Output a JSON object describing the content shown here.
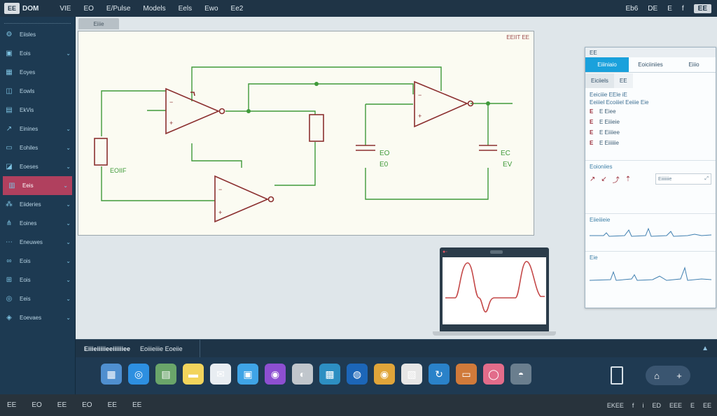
{
  "topbar": {
    "logo": "EE",
    "menu": [
      "DOM",
      "VIE",
      "EO",
      "E/Pulse",
      "Models",
      "Eels",
      "Ewo",
      "Ee2"
    ],
    "right": [
      "Eb6",
      "DE",
      "E",
      "f",
      "EE"
    ]
  },
  "sidebar": {
    "items": [
      {
        "icon": "gear-icon",
        "glyph": "⚙",
        "label": "Eiisles",
        "chevron": false
      },
      {
        "icon": "chip-icon",
        "glyph": "▣",
        "label": "Eois",
        "chevron": true
      },
      {
        "icon": "grid-icon",
        "glyph": "▦",
        "label": "Eoyes",
        "chevron": false
      },
      {
        "icon": "component-icon",
        "glyph": "◫",
        "label": "Eowls",
        "chevron": false
      },
      {
        "icon": "device-icon",
        "glyph": "▤",
        "label": "EkVis",
        "chevron": false
      },
      {
        "icon": "probe-icon",
        "glyph": "↗",
        "label": "Einines",
        "chevron": true
      },
      {
        "icon": "monitor-icon",
        "glyph": "▭",
        "label": "Eohiles",
        "chevron": true
      },
      {
        "icon": "chart-icon",
        "glyph": "◪",
        "label": "Eoeses",
        "chevron": true
      },
      {
        "icon": "layers-icon",
        "glyph": "▥",
        "label": "Eeis",
        "chevron": true,
        "active": true
      },
      {
        "icon": "network-icon",
        "glyph": "⁂",
        "label": "Eiideries",
        "chevron": true
      },
      {
        "icon": "branch-icon",
        "glyph": "⋔",
        "label": "Eoines",
        "chevron": true
      },
      {
        "icon": "nodes-icon",
        "glyph": "⋯",
        "label": "Eneuwes",
        "chevron": true
      },
      {
        "icon": "link-icon",
        "glyph": "∞",
        "label": "Eois",
        "chevron": true
      },
      {
        "icon": "tree-icon",
        "glyph": "⊞",
        "label": "Eois",
        "chevron": true
      },
      {
        "icon": "globe-icon",
        "glyph": "◎",
        "label": "Eeis",
        "chevron": true
      },
      {
        "icon": "tag-icon",
        "glyph": "◈",
        "label": "Eoevaes",
        "chevron": true
      }
    ]
  },
  "workspace": {
    "tab_label": "Eiiie",
    "schematic_title": "EEIIT EE",
    "labels": {
      "r1": "EOIIF",
      "c1": "EO",
      "c1v": "E0",
      "c2": "EC",
      "c2v": "EV"
    }
  },
  "props": {
    "header": "EE",
    "tabs": [
      "Eiiiniaio",
      "Eoiciiniies",
      "Eiiio"
    ],
    "subtab": "Eiciiels",
    "subtab2": "EE",
    "desc_lines": [
      "Eeiciiie EEle iE",
      "Eeiiiel Ecoiiiel Eeiiie Eie"
    ],
    "params": [
      {
        "k": "E",
        "v": "E Eiee"
      },
      {
        "k": "E",
        "v": "E Eiiieie"
      },
      {
        "k": "E",
        "v": "E Eiiiiee"
      },
      {
        "k": "E",
        "v": "E Eiiiiiie"
      }
    ],
    "section2_title": "Eoioniies",
    "input_text": "Eiiiiiiie",
    "section3_title": "Eiieiiieie",
    "section4_title": "Eie"
  },
  "console": {
    "tab1": "Eiiieiiiiieeiiiiiiee",
    "tab2": "Eoiiieiiie Eoeiie",
    "up": "▲"
  },
  "dock": {
    "icons": [
      {
        "name": "finder-icon",
        "color": "#4f8fcf",
        "glyph": "▦"
      },
      {
        "name": "safari-icon",
        "color": "#2d8fe0",
        "glyph": "◎"
      },
      {
        "name": "calc-icon",
        "color": "#6aa56a",
        "glyph": "▤"
      },
      {
        "name": "notes-icon",
        "color": "#f2d45c",
        "glyph": "▬"
      },
      {
        "name": "mail-icon",
        "color": "#e8edf2",
        "glyph": "✉"
      },
      {
        "name": "messages-icon",
        "color": "#3fa4e6",
        "glyph": "▣"
      },
      {
        "name": "podcast-icon",
        "color": "#8d4fd1",
        "glyph": "◉"
      },
      {
        "name": "photos-icon",
        "color": "#c0c6cc",
        "glyph": "◐"
      },
      {
        "name": "store-icon",
        "color": "#2d8fc2",
        "glyph": "▩"
      },
      {
        "name": "siri-icon",
        "color": "#1c66b8",
        "glyph": "◍"
      },
      {
        "name": "chrome-icon",
        "color": "#e0a53a",
        "glyph": "◉"
      },
      {
        "name": "calendar-icon",
        "color": "#e6e6e6",
        "glyph": "▧"
      },
      {
        "name": "sync-icon",
        "color": "#2a82c9",
        "glyph": "↻"
      },
      {
        "name": "screen-icon",
        "color": "#d07a3a",
        "glyph": "▭"
      },
      {
        "name": "camera-icon",
        "color": "#e26c8a",
        "glyph": "◯"
      },
      {
        "name": "disk-icon",
        "color": "#6a7e8e",
        "glyph": "◓"
      }
    ],
    "right_left": "⌂",
    "right_right": "+"
  },
  "statusbar": {
    "left": [
      "EE",
      "EO",
      "EE",
      "EO",
      "EE",
      "EE"
    ],
    "right": [
      "EKEE",
      "f",
      "i",
      "ED",
      "EEE",
      "E",
      "EE"
    ]
  }
}
